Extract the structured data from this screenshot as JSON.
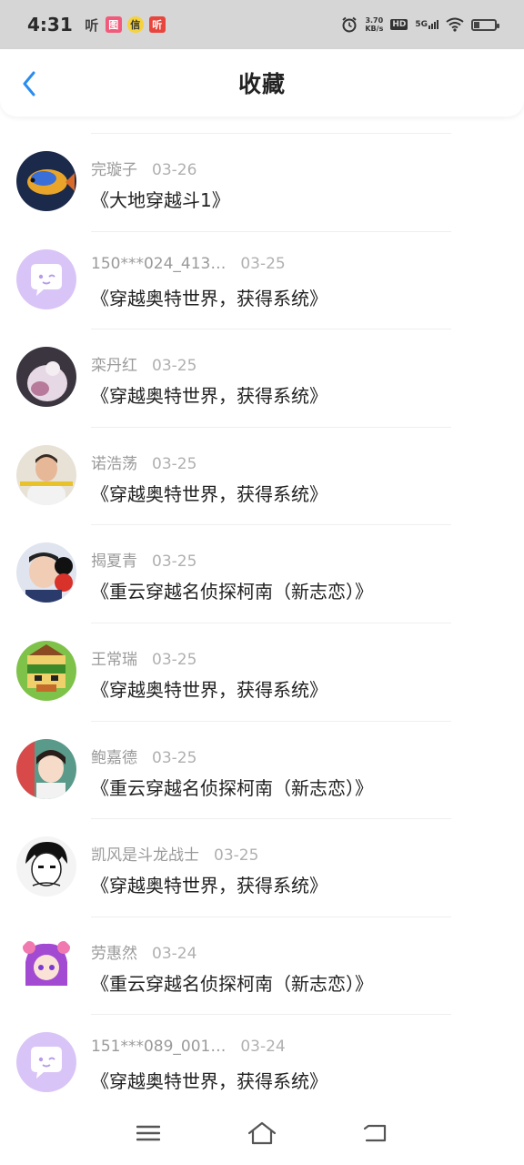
{
  "status_bar": {
    "time": "4:31",
    "app_icons": [
      "听",
      "图",
      "信",
      "听"
    ],
    "speed_value": "3.70",
    "speed_unit": "KB/s",
    "hd": "HD",
    "network": "5G"
  },
  "header": {
    "title": "收藏"
  },
  "favorites": [
    {
      "user": "完璇子",
      "date": "03-26",
      "book": "《大地穿越斗1》",
      "avatar": "fish"
    },
    {
      "user": "150***024_413…",
      "date": "03-25",
      "book": "《穿越奥特世界，获得系统》",
      "avatar": "default"
    },
    {
      "user": "栾丹红",
      "date": "03-25",
      "book": "《穿越奥特世界，获得系统》",
      "avatar": "photo-dark"
    },
    {
      "user": "诺浩荡",
      "date": "03-25",
      "book": "《穿越奥特世界，获得系统》",
      "avatar": "photo-boy"
    },
    {
      "user": "揭夏青",
      "date": "03-25",
      "book": "《重云穿越名侦探柯南（新志恋）》",
      "avatar": "photo-cat"
    },
    {
      "user": "王常瑞",
      "date": "03-25",
      "book": "《穿越奥特世界，获得系统》",
      "avatar": "pixel"
    },
    {
      "user": "鲍嘉德",
      "date": "03-25",
      "book": "《重云穿越名侦探柯南（新志恋）》",
      "avatar": "photo-girl"
    },
    {
      "user": "凯风是斗龙战士",
      "date": "03-25",
      "book": "《穿越奥特世界，获得系统》",
      "avatar": "anime-boy"
    },
    {
      "user": "劳惠然",
      "date": "03-24",
      "book": "《重云穿越名侦探柯南（新志恋）》",
      "avatar": "anime-girl"
    },
    {
      "user": "151***089_001…",
      "date": "03-24",
      "book": "《穿越奥特世界，获得系统》",
      "avatar": "default"
    }
  ],
  "colors": {
    "accent": "#2a8cf0",
    "default_avatar_bg": "#d9c4f7"
  }
}
